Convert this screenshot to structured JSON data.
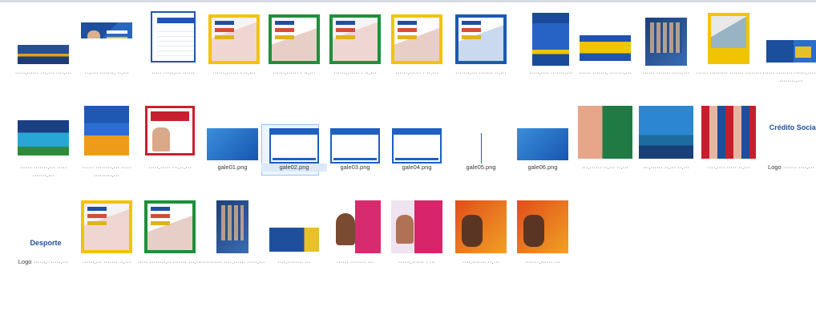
{
  "folder": {
    "files": [
      {
        "name": "thumb-1",
        "label": "·····.······ ···.··· ····.···",
        "art": "strip"
      },
      {
        "name": "thumb-2",
        "label": "··.···· ·······. ··.···",
        "art": "blueperson"
      },
      {
        "name": "thumb-3",
        "label": "····· ·····.··· ······",
        "art": "whiteform"
      },
      {
        "name": "thumb-4",
        "label": "······.······ · ··.···",
        "art": "yellowframe"
      },
      {
        "name": "thumb-5",
        "label": "······.······ · ··.···",
        "art": "greenframe"
      },
      {
        "name": "thumb-6",
        "label": "······.······ · ··.···",
        "art": "greenframe-b"
      },
      {
        "name": "thumb-7",
        "label": "······.······ · ··.···",
        "art": "yellowframe-b"
      },
      {
        "name": "thumb-8",
        "label": "·······.··· ······· ··.···",
        "art": "blueframe"
      },
      {
        "name": "thumb-9",
        "label": "·····.···· ·······.···",
        "art": "poster"
      },
      {
        "name": "thumb-10",
        "label": "······ ·······. ·······.···",
        "art": "yellowbar"
      },
      {
        "name": "thumb-11",
        "label": "······ ······· ·····.···",
        "art": "gridpeople"
      },
      {
        "name": "thumb-12",
        "label": "······ ········· ······· ········",
        "art": "yellowphoto"
      },
      {
        "name": "thumb-13",
        "label": "······ ········ ······.······ ········.···",
        "art": "bluebanner"
      },
      {
        "name": "thumb-14",
        "label": "······ ·······.··· ····· ·······.···",
        "art": "photoblue"
      },
      {
        "name": "thumb-15",
        "label": "······ ········.··· ····· ·········.···",
        "art": "orangeblue"
      },
      {
        "name": "thumb-16",
        "label": "·····.····· ···.··.···",
        "art": "redflyer"
      },
      {
        "name": "thumb-17",
        "label": "gale01.png",
        "art": "bluegrad"
      },
      {
        "name": "thumb-18",
        "label": "gale02.png",
        "art": "win"
      },
      {
        "name": "thumb-19",
        "label": "gale03.png",
        "art": "win"
      },
      {
        "name": "thumb-20",
        "label": "gale04.png",
        "art": "win"
      },
      {
        "name": "thumb-21",
        "label": "gale05.png",
        "art": "winsplit"
      },
      {
        "name": "thumb-22",
        "label": "gale06.png",
        "art": "bluegrad"
      },
      {
        "name": "thumb-23",
        "label": "···.······ ··.··· ··.···",
        "art": "green"
      },
      {
        "name": "thumb-24",
        "label": "···.······ ··.··· ··.···",
        "art": "sky"
      },
      {
        "name": "thumb-25",
        "label": "····.···· ····· ··.···",
        "art": "redgrid"
      },
      {
        "name": "thumb-26",
        "label": "Logo ······· ····.···",
        "art": "logo",
        "logo_text": "Crédito Social"
      },
      {
        "name": "thumb-27",
        "label": "Logo ······.· ·····.···",
        "art": "logo",
        "logo_text": "Desporte"
      },
      {
        "name": "thumb-28",
        "label": "······.··· ······· ··.···",
        "art": "yellowframe-c"
      },
      {
        "name": "thumb-29",
        "label": "····· ········.·· ······· ···.···",
        "art": "greenframe-c"
      },
      {
        "name": "thumb-30",
        "label": "··········· ····.······ ·····.···",
        "art": "gridpeople"
      },
      {
        "name": "thumb-31",
        "label": "····.········ ···",
        "art": "slim"
      },
      {
        "name": "thumb-32",
        "label": "······ ········ ···",
        "art": "kid"
      },
      {
        "name": "thumb-33",
        "label": "······.······ · ···",
        "art": "pink"
      },
      {
        "name": "thumb-34",
        "label": "····.······· ··.···",
        "art": "orange"
      },
      {
        "name": "thumb-35",
        "label": "·······.······ ···",
        "art": "orange"
      }
    ]
  }
}
